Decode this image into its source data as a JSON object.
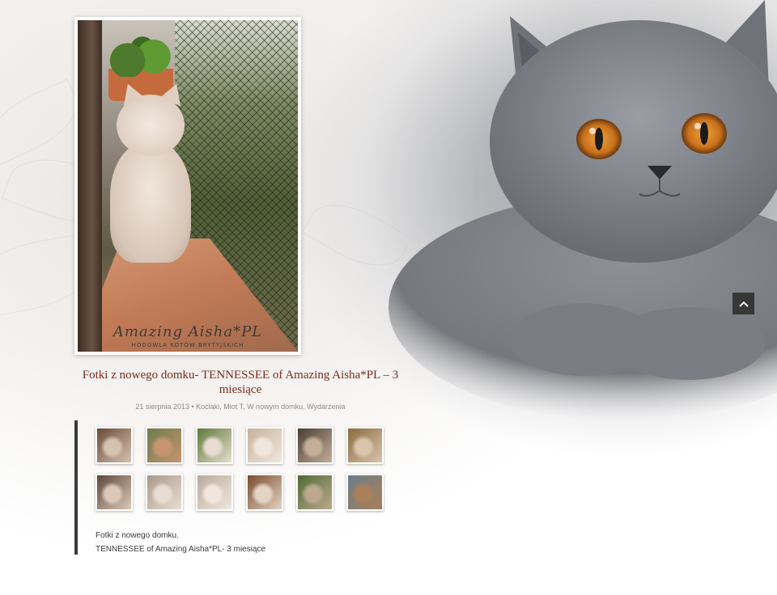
{
  "post": {
    "title": "Fotki z nowego domku- TENNESSEE of Amazing Aisha*PL – 3 miesiące",
    "date": "21 sierpnia 2013",
    "separator": "•",
    "categories": [
      "Kociaki",
      "Miot T",
      "W nowym domku",
      "Wydarzenia"
    ],
    "caption_line1": "Fotki z nowego domku.",
    "caption_line2": "TENNESSEE of Amazing Aisha*PL- 3 miesiące"
  },
  "featured": {
    "watermark": "Amazing Aisha",
    "watermark_suffix": "PL",
    "watermark_sub": "HODOWLA KOTÓW BRYTYJSKICH"
  },
  "gallery": {
    "thumbnails": [
      {
        "name": "kitten-at-lattice",
        "colors": [
          "#6a4a36",
          "#d6c2b0"
        ]
      },
      {
        "name": "kitten-on-balcony",
        "colors": [
          "#6c7d4c",
          "#c89470"
        ]
      },
      {
        "name": "kitten-lying-green",
        "colors": [
          "#5d7a3a",
          "#e7dccf"
        ]
      },
      {
        "name": "kitten-sleeping",
        "colors": [
          "#c7b29c",
          "#efe6dc"
        ]
      },
      {
        "name": "kitten-closeup-dark",
        "colors": [
          "#4a3e34",
          "#c4ae98"
        ]
      },
      {
        "name": "kitten-in-basket",
        "colors": [
          "#8a6a3e",
          "#d9c4ac"
        ]
      },
      {
        "name": "kitten-at-lattice-2",
        "colors": [
          "#5d4638",
          "#dbc8b8"
        ]
      },
      {
        "name": "kitten-face-light",
        "colors": [
          "#a89888",
          "#e8ddd3"
        ]
      },
      {
        "name": "kitten-portrait",
        "colors": [
          "#b9aa9a",
          "#f0e6dc"
        ]
      },
      {
        "name": "kitten-on-chair",
        "colors": [
          "#7a4a2e",
          "#e3d3c3"
        ]
      },
      {
        "name": "kitten-in-garden",
        "colors": [
          "#4f6a34",
          "#bba88e"
        ]
      },
      {
        "name": "kitten-in-basket-2",
        "colors": [
          "#6a7d8a",
          "#a9805a"
        ]
      }
    ]
  },
  "ui": {
    "scroll_top_icon": "chevron-up-icon"
  },
  "colors": {
    "title": "#7b2a1e",
    "meta": "#8a8a8a",
    "content_border": "#3a3a3a"
  }
}
